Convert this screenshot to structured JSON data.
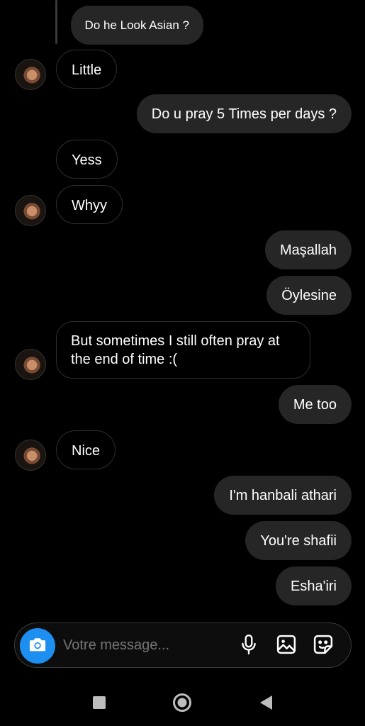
{
  "messages": {
    "reply_quote": "Do he Look Asian ?",
    "m1": "Little",
    "m2": "Do u pray 5 Times per days ?",
    "m3": "Yess",
    "m4": "Whyy",
    "m5": "Maşallah",
    "m6": "Öylesine",
    "m7": "But sometimes I still often pray at the end of time :(",
    "m8": "Me too",
    "m9": "Nice",
    "m10": "I'm hanbali athari",
    "m11": "You're shafii",
    "m12": "Esha'iri"
  },
  "composer": {
    "placeholder": "Votre message...",
    "icons": [
      "camera-icon",
      "microphone-icon",
      "gallery-icon",
      "sticker-icon"
    ]
  },
  "nav": {
    "icons": [
      "recents-square-icon",
      "home-circle-icon",
      "back-triangle-icon"
    ]
  },
  "colors": {
    "accent": "#1d8ff0",
    "outgoing_bubble": "#262626",
    "background": "#000000"
  }
}
